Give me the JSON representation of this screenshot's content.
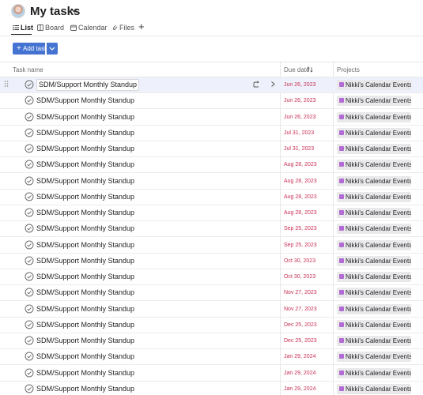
{
  "header": {
    "title": "My tasks"
  },
  "tabs": [
    {
      "label": "List",
      "icon": "list-icon"
    },
    {
      "label": "Board",
      "icon": "board-icon"
    },
    {
      "label": "Calendar",
      "icon": "calendar-icon"
    },
    {
      "label": "Files",
      "icon": "files-icon"
    }
  ],
  "toolbar": {
    "add_task_label": "Add task"
  },
  "columns": {
    "task_name": "Task name",
    "due_date": "Due date",
    "projects": "Projects"
  },
  "rows": [
    {
      "name": "SDM/Support Monthly Standup",
      "due": "Jun 26, 2023",
      "project": "Nikki's Calendar Events"
    },
    {
      "name": "SDM/Support Monthly Standup",
      "due": "Jun 26, 2023",
      "project": "Nikki's Calendar Events"
    },
    {
      "name": "SDM/Support Monthly Standup",
      "due": "Jun 26, 2023",
      "project": "Nikki's Calendar Events"
    },
    {
      "name": "SDM/Support Monthly Standup",
      "due": "Jul 31, 2023",
      "project": "Nikki's Calendar Events"
    },
    {
      "name": "SDM/Support Monthly Standup",
      "due": "Jul 31, 2023",
      "project": "Nikki's Calendar Events"
    },
    {
      "name": "SDM/Support Monthly Standup",
      "due": "Aug 28, 2023",
      "project": "Nikki's Calendar Events"
    },
    {
      "name": "SDM/Support Monthly Standup",
      "due": "Aug 28, 2023",
      "project": "Nikki's Calendar Events"
    },
    {
      "name": "SDM/Support Monthly Standup",
      "due": "Aug 28, 2023",
      "project": "Nikki's Calendar Events"
    },
    {
      "name": "SDM/Support Monthly Standup",
      "due": "Aug 28, 2023",
      "project": "Nikki's Calendar Events"
    },
    {
      "name": "SDM/Support Monthly Standup",
      "due": "Sep 25, 2023",
      "project": "Nikki's Calendar Events"
    },
    {
      "name": "SDM/Support Monthly Standup",
      "due": "Sep 25, 2023",
      "project": "Nikki's Calendar Events"
    },
    {
      "name": "SDM/Support Monthly Standup",
      "due": "Oct 30, 2023",
      "project": "Nikki's Calendar Events"
    },
    {
      "name": "SDM/Support Monthly Standup",
      "due": "Oct 30, 2023",
      "project": "Nikki's Calendar Events"
    },
    {
      "name": "SDM/Support Monthly Standup",
      "due": "Nov 27, 2023",
      "project": "Nikki's Calendar Events"
    },
    {
      "name": "SDM/Support Monthly Standup",
      "due": "Nov 27, 2023",
      "project": "Nikki's Calendar Events"
    },
    {
      "name": "SDM/Support Monthly Standup",
      "due": "Dec 25, 2023",
      "project": "Nikki's Calendar Events"
    },
    {
      "name": "SDM/Support Monthly Standup",
      "due": "Dec 25, 2023",
      "project": "Nikki's Calendar Events"
    },
    {
      "name": "SDM/Support Monthly Standup",
      "due": "Jan 29, 2024",
      "project": "Nikki's Calendar Events"
    },
    {
      "name": "SDM/Support Monthly Standup",
      "due": "Jan 29, 2024",
      "project": "Nikki's Calendar Events"
    },
    {
      "name": "SDM/Support Monthly Standup",
      "due": "Jan 29, 2024",
      "project": "Nikki's Calendar Events"
    }
  ],
  "colors": {
    "accent": "#4573d2",
    "due_overdue": "#c92f54",
    "project_dot": "#b36bd4",
    "selected_row": "#eef1fb"
  }
}
